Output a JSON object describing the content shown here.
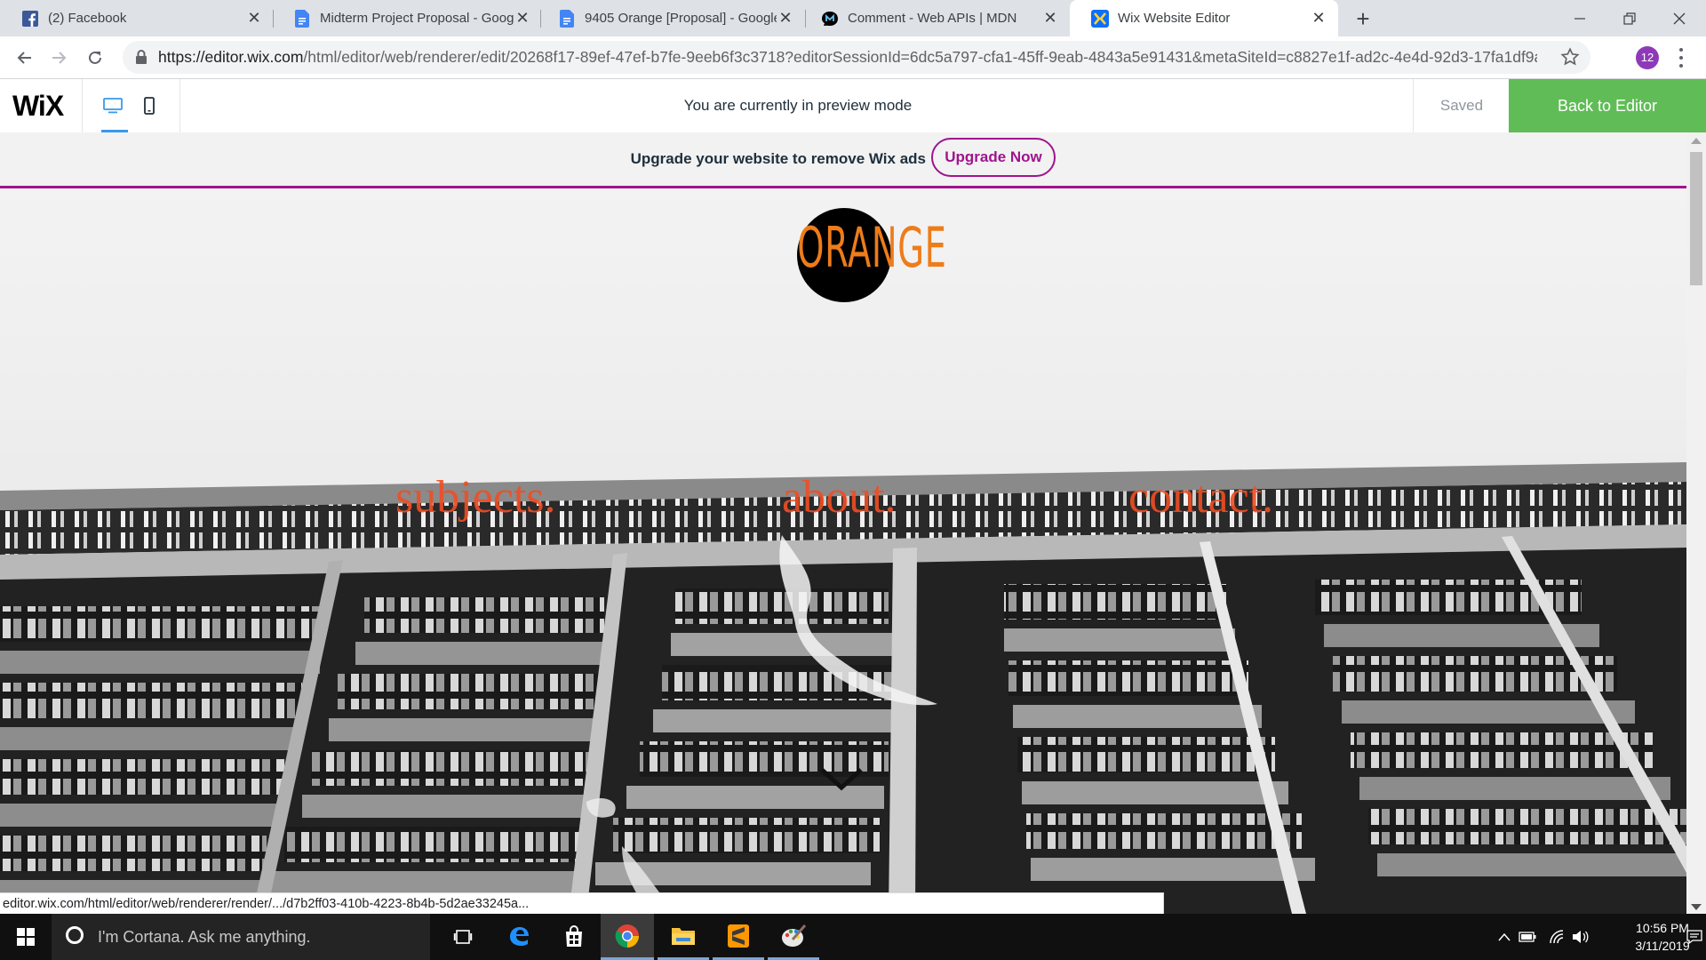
{
  "browser": {
    "tabs": [
      {
        "title": "(2) Facebook",
        "icon": "facebook-icon",
        "active": false
      },
      {
        "title": "Midterm Project Proposal - Goog",
        "icon": "google-docs-icon",
        "active": false
      },
      {
        "title": "9405 Orange [Proposal] - Google",
        "icon": "google-docs-icon",
        "active": false
      },
      {
        "title": "Comment - Web APIs | MDN",
        "icon": "mdn-icon",
        "active": false
      },
      {
        "title": "Wix Website Editor",
        "icon": "wix-icon",
        "active": true
      }
    ],
    "new_tab_symbol": "+",
    "url_host": "https://editor.wix.com",
    "url_path": "/html/editor/web/renderer/edit/20268f17-89ef-47ef-b7fe-9eeb6f3c3718?editorSessionId=6dc5a797-cfa1-45ff-9eab-4843a5e91431&metaSiteId=c8827e1f-ad2c-4e4d-92d3-17fa1df9a...",
    "profile_badge": "12",
    "status_url": "editor.wix.com/html/editor/web/renderer/render/.../d7b2ff03-410b-4223-8b4b-5d2ae33245a..."
  },
  "wix_bar": {
    "logo": "WiX",
    "preview_message": "You are currently in preview mode",
    "saved_label": "Saved",
    "back_button": "Back to Editor",
    "accent": "#60bc57"
  },
  "upgrade_banner": {
    "message": "Upgrade your website to remove Wix ads",
    "button": "Upgrade Now",
    "accent": "#a0138e"
  },
  "site": {
    "logo_text": "ORANGE",
    "logo_color": "#ee7c1a",
    "nav": [
      {
        "label": "subjects."
      },
      {
        "label": "about."
      },
      {
        "label": "contact."
      }
    ],
    "nav_color": "#f04e23",
    "scroll_icon": "chevron-down-icon"
  },
  "taskbar": {
    "cortana_placeholder": "I'm Cortana. Ask me anything.",
    "apps": [
      "task-view-icon",
      "edge-icon",
      "store-icon",
      "chrome-icon",
      "file-explorer-icon",
      "sublime-text-icon",
      "paint-icon"
    ],
    "time": "10:56 PM",
    "date": "3/11/2019"
  }
}
